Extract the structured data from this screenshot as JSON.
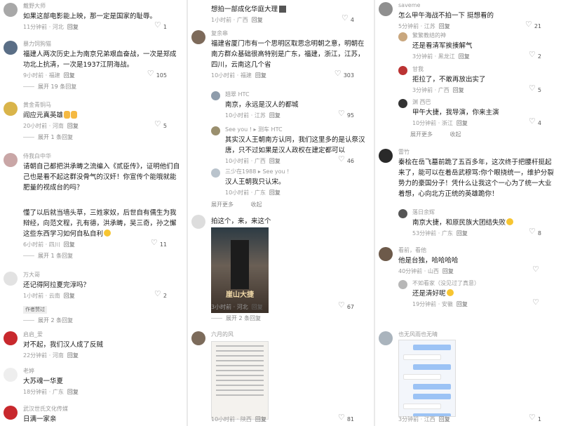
{
  "col_a": [
    {
      "user": "戴野大师",
      "text": "如果这部电影能上映，那一定是国家的耻辱。",
      "time": "11分钟前",
      "loc": "河北",
      "reply": "回复",
      "likes": "1",
      "avatar_color": "#a8a8a8"
    },
    {
      "user": "暴力饲狗猫",
      "text": "福建人两次历史上为南京兄弟艰血奋战，一次是郑成功北上抗清，一次是1937江阴海战。",
      "time": "9小时前",
      "loc": "福建",
      "reply": "回复",
      "likes": "105",
      "more": "展开 19 条回复",
      "avatar_color": "#5a6e86"
    },
    {
      "user": "黄金青铜马",
      "text": "阎应元真英雄",
      "time": "20小时前",
      "loc": "河南",
      "reply": "回复",
      "likes": "5",
      "more": "展开 1 条回复",
      "avatar_color": "#d9b44a"
    },
    {
      "user": "侍我白中华",
      "text": "请朝自己都把洪承畴之流编入《贰臣传》，证明他们自己也是看不起这群没骨气的汉奸！你宣传个能哦就能肥量的视成台的吗？",
      "time": "",
      "loc": "",
      "reply": "",
      "likes": "",
      "avatar_color": "#c9a6a6"
    },
    {
      "user": "",
      "text": "懂了以后就当墙头草，三姓家奴，后世自有儒生为我辩经，向范文程，孔有德，洪承畴，吴三奇，孙之懈这些东西学习如何自私自利",
      "time": "6小时前",
      "loc": "四川",
      "reply": "回复",
      "likes": "11",
      "more": "展开 1 条回复",
      "avatar_color": "#ffffff"
    },
    {
      "user": "万大哥",
      "text": "还记得阿拉夏完淳吗？",
      "time": "1小时前",
      "loc": "云南",
      "reply": "回复",
      "likes": "2",
      "badge": "作者赞过",
      "more": "展开 2 条回复",
      "avatar_color": "#e2e2e2"
    },
    {
      "user": "启启_爱",
      "text": "对不起，我们汉人成了反贼",
      "time": "22分钟前",
      "loc": "河南",
      "reply": "回复",
      "likes": "",
      "avatar_color": "#c8282d"
    },
    {
      "user": "老婷",
      "text": "大苏魂一华夏",
      "time": "18分钟前",
      "loc": "广东",
      "reply": "回复",
      "likes": "",
      "avatar_color": "#eeeeee"
    },
    {
      "user": "武汉世氏文化传媒",
      "text": "日满一家亲",
      "time": "",
      "loc": "",
      "reply": "",
      "likes": "",
      "avatar_color": "#c8282d"
    }
  ],
  "col_b": [
    {
      "user": "",
      "text": "想拍一部成化华庭大理",
      "time": "1小时前",
      "loc": "广西",
      "reply": "回复",
      "likes": "4"
    },
    {
      "user": "复余串",
      "text": "福建省厦门市有一个思明区取思念明朝之意，明朝在南方群众基础很高特别是广东，福建，浙江，江苏，四川，云南这几个省",
      "time": "10小时前",
      "loc": "福建",
      "reply": "回复",
      "likes": "303",
      "avatar_color": "#7d6a5a"
    },
    {
      "user": "翘翠 HTC",
      "text": "南京，永远是汉人的都城",
      "time": "10小时前",
      "loc": "江苏",
      "reply": "回复",
      "likes": "95",
      "avatar_color": "#8e9cab"
    },
    {
      "user": "See you ! ▸ 测车 HTC",
      "text": "其实汉人王朝南方认同，我们这里多的是认祭汉唐，只不过如果是汉人政权在建定都可以",
      "time": "10小时前",
      "loc": "广西",
      "reply": "回复",
      "likes": "46",
      "avatar_color": "#9a8f6e"
    },
    {
      "user": "三少在1988 ▸ See you !",
      "text": "汉人王朝我只认宋。",
      "time": "10小时前",
      "loc": "广东",
      "reply": "回复",
      "likes": "",
      "avatar_color": "#b9c3cc"
    },
    {
      "more": "展开更多",
      "collapse": "收起"
    },
    {
      "user": "",
      "text": "拍这个，来，来这个",
      "time": "3小时前",
      "loc": "河北",
      "reply": "回复",
      "likes": "67",
      "poster_title": "崖山大捷",
      "more": "展开 2 条回复"
    },
    {
      "user": "六月的风",
      "text": "",
      "time": "10小时前",
      "loc": "陕西",
      "reply": "回复",
      "likes": "81",
      "avatar_color": "#7c6b5b"
    }
  ],
  "col_c": [
    {
      "user": "saveme",
      "text": "怎么甲午海战不拍一下 挺想看的",
      "time": "5分钟前",
      "loc": "江苏",
      "reply": "回复",
      "likes": "21",
      "avatar_color": "#8f8f8f"
    },
    {
      "user": "繁繁教结的神",
      "text": "还是看清军挨揍解气",
      "time": "3分钟前",
      "loc": "黑龙江",
      "reply": "回复",
      "likes": "2",
      "avatar_color": "#c9a77e"
    },
    {
      "user": "甘我",
      "text": "拒拉了，不敢再放出实了",
      "time": "3分钟前",
      "loc": "广西",
      "reply": "回复",
      "likes": "5",
      "avatar_color": "#bb3333"
    },
    {
      "user": "渊 西巴",
      "text": "甲午大捷，我导演，你来主演",
      "time": "10分钟前",
      "loc": "浙江",
      "reply": "回复",
      "likes": "4",
      "avatar_color": "#333"
    },
    {
      "more": "展开更多",
      "collapse": "收起"
    },
    {
      "user": "雷竹",
      "text": "秦桧在岳飞墓前跪了五百多年，这次终于把腰杆挺起来了，能可以在着岳武穆骂:你个眼挠统一，维护分裂势力的豪国分子！凭什么让我这个一心为了统一大业着想，心向北方正统的英雄跪你！",
      "time": "",
      "loc": "",
      "reply": "",
      "likes": "",
      "avatar_color": "#2a2a2a"
    },
    {
      "user": "落日余辉",
      "text": "南京大捷，和原民族大团结失败",
      "time": "53分钟前",
      "loc": "广东",
      "reply": "回复",
      "likes": "8",
      "avatar_color": "#555"
    },
    {
      "user": "看前，看他",
      "text": "他是台独，哈哈哈哈",
      "time": "40分钟前",
      "loc": "山西",
      "reply": "回复",
      "likes": "",
      "avatar_color": "#6d5a4a"
    },
    {
      "user": "不如看家（没见过了真意）",
      "text": "还是清好呢",
      "time": "19分钟前",
      "loc": "安徽",
      "reply": "回复",
      "likes": "",
      "avatar_color": "#b7b7b7"
    },
    {
      "user": "也无风雨也无晴",
      "text": "",
      "time": "3分钟前",
      "loc": "江西",
      "reply": "回复",
      "likes": "1",
      "avatar_color": "#aab4bd"
    }
  ]
}
